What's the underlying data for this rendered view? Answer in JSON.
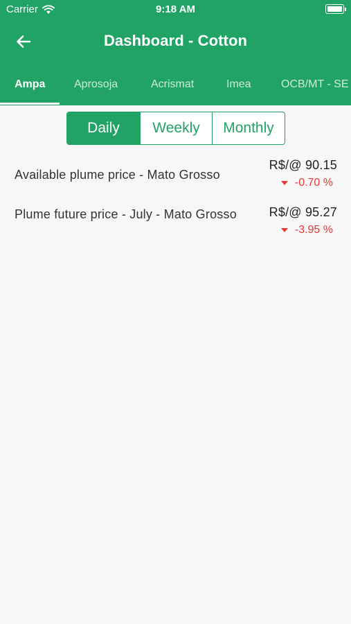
{
  "status_bar": {
    "carrier": "Carrier",
    "time": "9:18 AM"
  },
  "header": {
    "title": "Dashboard - Cotton",
    "background_color": "#21a366",
    "back_icon": "arrow-left-icon"
  },
  "tabs": [
    {
      "label": "Ampa",
      "active": true
    },
    {
      "label": "Aprosoja",
      "active": false
    },
    {
      "label": "Acrismat",
      "active": false
    },
    {
      "label": "Imea",
      "active": false
    },
    {
      "label": "OCB/MT - SE",
      "active": false
    }
  ],
  "period_selector": {
    "options": [
      "Daily",
      "Weekly",
      "Monthly"
    ],
    "selected": "Daily"
  },
  "prices": [
    {
      "label": "Available plume price - Mato Grosso",
      "price": "R$/@ 90.15",
      "change": "-0.70 %",
      "trend": "down"
    },
    {
      "label": "Plume future price - July - Mato Grosso",
      "price": "R$/@ 95.27",
      "change": "-3.95 %",
      "trend": "down"
    }
  ],
  "colors": {
    "accent": "#21a366",
    "negative": "#e53935"
  }
}
